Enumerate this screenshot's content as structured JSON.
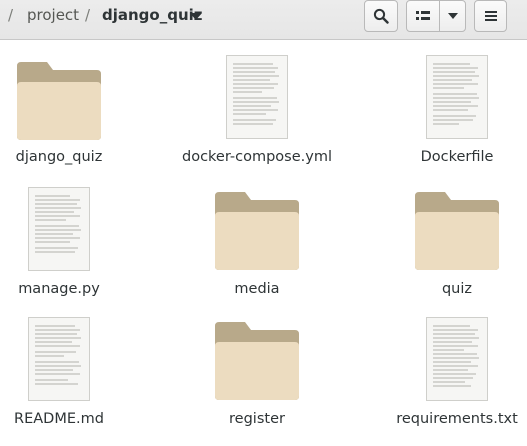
{
  "window": {
    "accent_folder_back": "#b8a98a",
    "accent_folder_front": "#ecdcc0"
  },
  "breadcrumb": {
    "separator": "/",
    "items": [
      {
        "label": "project"
      },
      {
        "label": "django_quiz",
        "current": true
      }
    ]
  },
  "toolbar": {
    "search_icon": "search-icon",
    "view_icon": "list-view-icon",
    "view_options_icon": "chevron-down-icon",
    "menu_icon": "hamburger-menu-icon"
  },
  "files": [
    {
      "name": "django_quiz",
      "kind": "folder"
    },
    {
      "name": "docker-compose.yml",
      "kind": "document"
    },
    {
      "name": "Dockerfile",
      "kind": "document"
    },
    {
      "name": "manage.py",
      "kind": "document"
    },
    {
      "name": "media",
      "kind": "folder"
    },
    {
      "name": "quiz",
      "kind": "folder"
    },
    {
      "name": "README.md",
      "kind": "document"
    },
    {
      "name": "register",
      "kind": "folder"
    },
    {
      "name": "requirements.txt",
      "kind": "document"
    }
  ]
}
